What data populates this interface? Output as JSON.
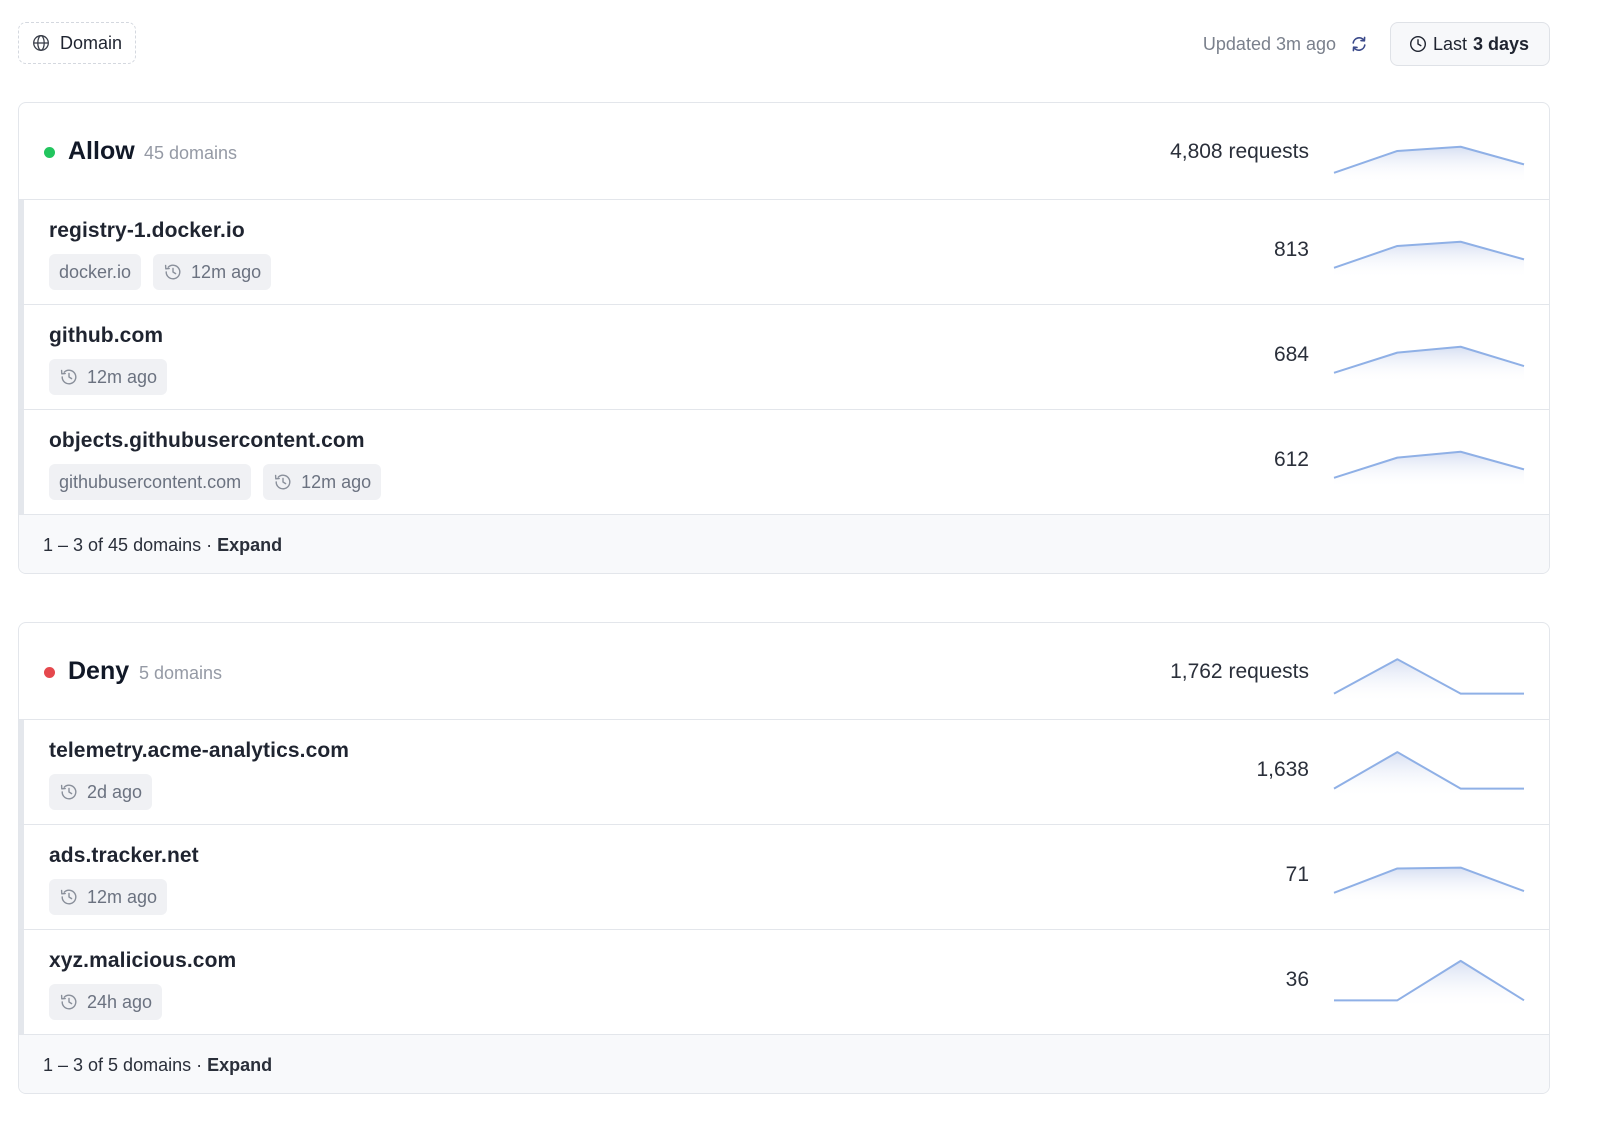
{
  "toolbar": {
    "filter_label": "Domain",
    "updated_text": "Updated 3m ago",
    "range_prefix": "Last",
    "range_value": "3 days"
  },
  "colors": {
    "allow": "#22c55e",
    "deny": "#e5484d",
    "spark_line": "#8fb0e6"
  },
  "groups": [
    {
      "key": "allow",
      "title": "Allow",
      "count_text": "45 domains",
      "requests_text": "4,808 requests",
      "trend": [
        0.1,
        0.62,
        0.72,
        0.3
      ],
      "rows": [
        {
          "name": "registry-1.docker.io",
          "tags": [
            {
              "text": "docker.io",
              "icon": ""
            },
            {
              "text": "12m ago",
              "icon": "history-icon"
            }
          ],
          "value": "813",
          "trend": [
            0.1,
            0.62,
            0.72,
            0.3
          ]
        },
        {
          "name": "github.com",
          "tags": [
            {
              "text": "12m ago",
              "icon": "history-icon"
            }
          ],
          "value": "684",
          "trend": [
            0.1,
            0.58,
            0.72,
            0.26
          ]
        },
        {
          "name": "objects.githubusercontent.com",
          "tags": [
            {
              "text": "githubusercontent.com",
              "icon": ""
            },
            {
              "text": "12m ago",
              "icon": "history-icon"
            }
          ],
          "value": "612",
          "trend": [
            0.1,
            0.58,
            0.72,
            0.3
          ]
        }
      ],
      "footer_range": "1 – 3 of 45 domains · ",
      "footer_action": "Expand"
    },
    {
      "key": "deny",
      "title": "Deny",
      "count_text": "5 domains",
      "requests_text": "1,762 requests",
      "trend": [
        0.08,
        0.9,
        0.08,
        0.08
      ],
      "rows": [
        {
          "name": "telemetry.acme-analytics.com",
          "tags": [
            {
              "text": "2d ago",
              "icon": "history-icon"
            }
          ],
          "value": "1,638",
          "trend": [
            0.08,
            0.95,
            0.08,
            0.08
          ]
        },
        {
          "name": "ads.tracker.net",
          "tags": [
            {
              "text": "12m ago",
              "icon": "history-icon"
            }
          ],
          "value": "71",
          "trend": [
            0.1,
            0.68,
            0.7,
            0.14
          ]
        },
        {
          "name": "xyz.malicious.com",
          "tags": [
            {
              "text": "24h ago",
              "icon": "history-icon"
            }
          ],
          "value": "36",
          "trend": [
            0.04,
            0.04,
            0.98,
            0.04
          ]
        }
      ],
      "footer_range": "1 – 3 of 5 domains · ",
      "footer_action": "Expand"
    }
  ]
}
